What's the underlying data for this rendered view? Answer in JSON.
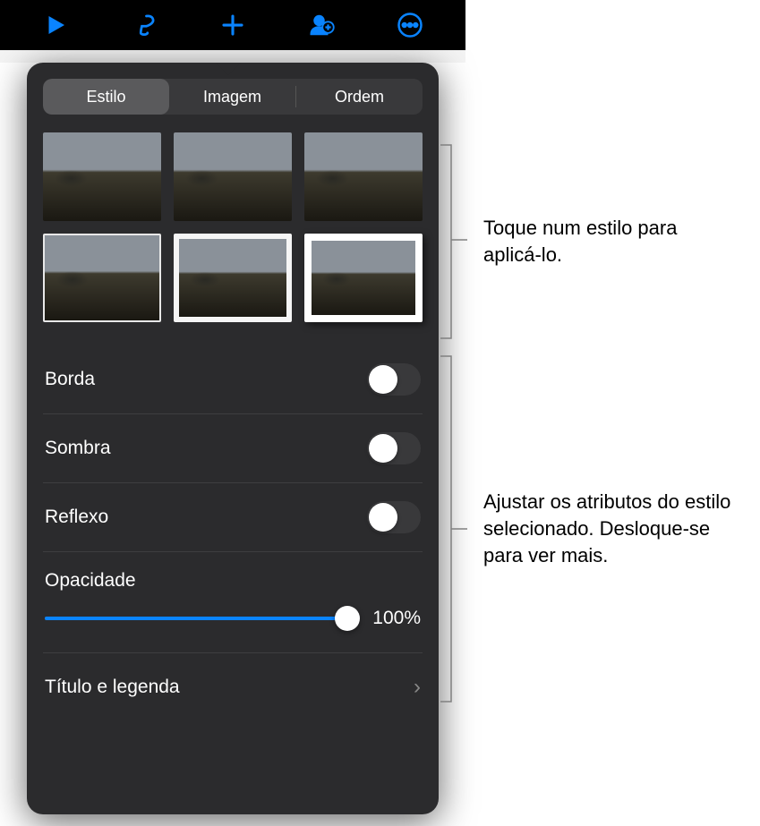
{
  "toolbar": {
    "icons": [
      "play-icon",
      "brush-icon",
      "plus-icon",
      "person-add-icon",
      "more-icon"
    ]
  },
  "tabs": {
    "estilo": "Estilo",
    "imagem": "Imagem",
    "ordem": "Ordem"
  },
  "rows": {
    "borda": "Borda",
    "sombra": "Sombra",
    "reflexo": "Reflexo",
    "opacidade": "Opacidade",
    "titulo_legenda": "Título e legenda"
  },
  "opacity": {
    "value_label": "100%",
    "percent": 100
  },
  "callouts": {
    "styles": "Toque num estilo para aplicá-lo.",
    "attributes": "Ajustar os atributos do estilo selecionado. Desloque-se para ver mais."
  }
}
